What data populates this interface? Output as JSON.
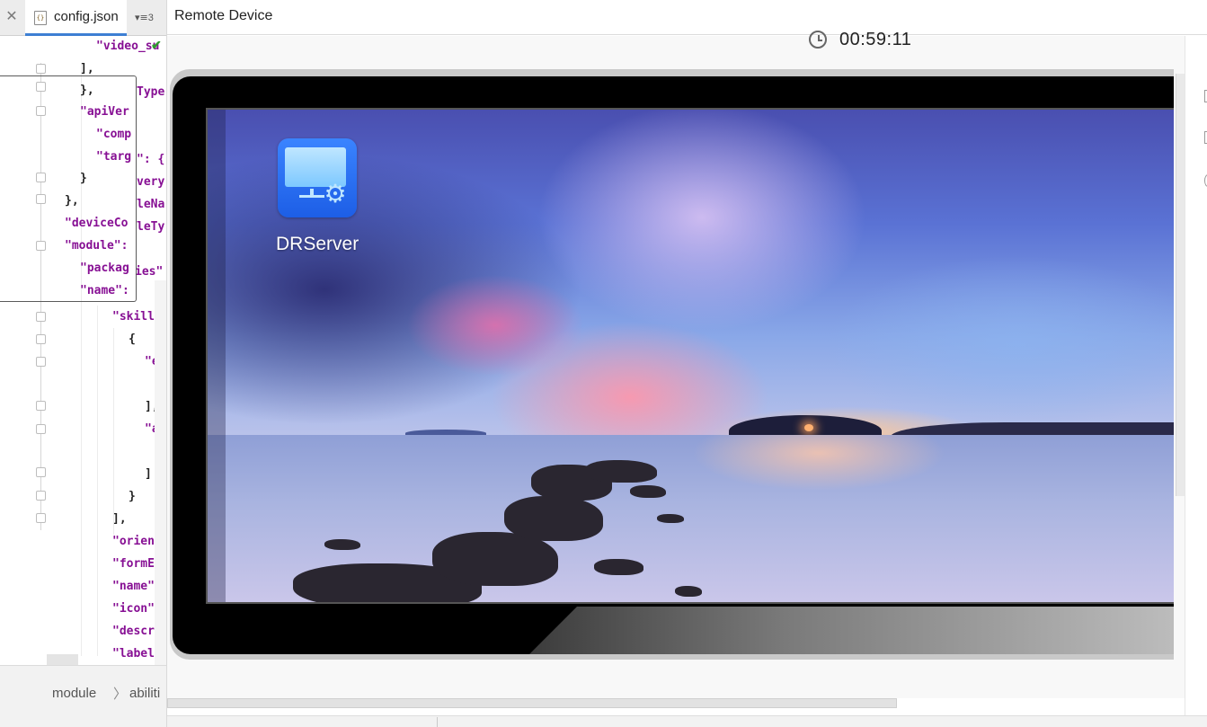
{
  "editor": {
    "tab": {
      "close_glyph": "✕",
      "file_icon_text": "{}",
      "file_name": "config.json",
      "overflow_icon": "▾≡",
      "overflow_count": "3"
    },
    "code_lines": [
      {
        "text": "\"video_su"
      },
      {
        "text": "],"
      },
      {
        "text": "},"
      },
      {
        "text": "\"apiVer"
      },
      {
        "text": "\"comp"
      },
      {
        "text": "\"targ"
      },
      {
        "text": "}"
      },
      {
        "text": "},"
      },
      {
        "text": "\"deviceCo"
      },
      {
        "text": "\"module\":"
      },
      {
        "text": "\"packag"
      },
      {
        "text": "\"name\":"
      },
      {
        "text": "\"skills"
      },
      {
        "text": "{"
      },
      {
        "text": "\"er"
      },
      {
        "text": "\""
      },
      {
        "text": "],"
      },
      {
        "text": "\"ac"
      },
      {
        "text": "\""
      },
      {
        "text": "]"
      },
      {
        "text": "}"
      },
      {
        "text": "],"
      },
      {
        "text": "\"orient"
      },
      {
        "text": "\"formEr"
      },
      {
        "text": "\"name\":"
      },
      {
        "text": "\"icon\":"
      },
      {
        "text": "\"descri"
      },
      {
        "text": "\"label\""
      }
    ],
    "behind_popup": [
      "Type",
      "\": {",
      "very",
      "leNa",
      "leTy",
      "ies\""
    ],
    "breadcrumb": {
      "module": "module",
      "separator": "〉",
      "abilities": "abiliti"
    }
  },
  "device": {
    "title": "Remote Device",
    "timer": "00:59:11",
    "app": {
      "label": "DRServer",
      "gear_glyph": "⚙"
    }
  },
  "colors": {
    "accent": "#3d7fd3",
    "app_icon": "#1d5ee6",
    "keyword": "#871094"
  }
}
